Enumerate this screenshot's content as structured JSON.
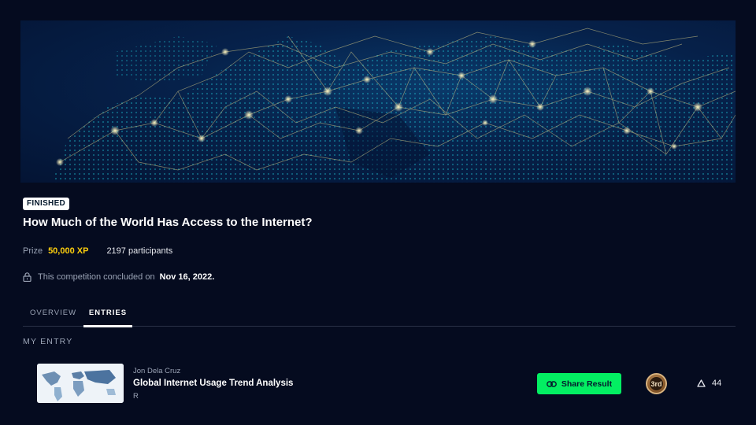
{
  "competition": {
    "status": "FINISHED",
    "title": "How Much of the World Has Access to the Internet?",
    "prize_label": "Prize",
    "prize_value": "50,000 XP",
    "participants": "2197 participants",
    "concluded_text": "This competition concluded on",
    "concluded_date": "Nov 16, 2022."
  },
  "tabs": [
    {
      "label": "OVERVIEW",
      "active": false
    },
    {
      "label": "ENTRIES",
      "active": true
    }
  ],
  "my_entry": {
    "section_label": "MY ENTRY",
    "author": "Jon Dela Cruz",
    "title": "Global Internet Usage Trend Analysis",
    "language": "R",
    "share_label": "Share Result",
    "rank": "3rd",
    "upvotes": "44"
  },
  "icons": {
    "lock": "lock-icon",
    "link": "link-icon",
    "medal": "medal-icon",
    "upvote": "triangle-up-icon"
  },
  "colors": {
    "background": "#050b1f",
    "prize": "#fcce0d",
    "share_button": "#03ef62",
    "badge_bg": "#ffffff"
  }
}
